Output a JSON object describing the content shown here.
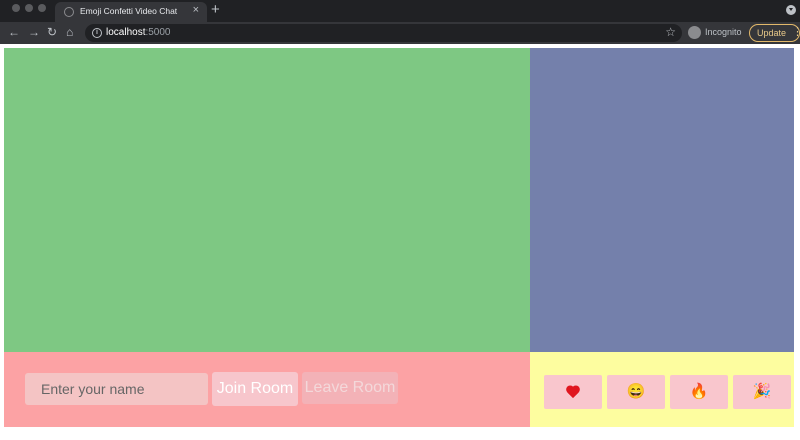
{
  "browser": {
    "tab_title": "Emoji Confetti Video Chat",
    "tab_close": "×",
    "new_tab": "+",
    "url_host": "localhost",
    "url_port": ":5000",
    "incognito_label": "Incognito",
    "update_label": "Update",
    "icons": [
      "back-icon",
      "forward-icon",
      "reload-icon",
      "home-icon",
      "info-icon",
      "star-icon",
      "incognito-icon",
      "menu-dots-icon"
    ]
  },
  "video": {
    "main_color": "#7ec883",
    "side_color": "#7480ab"
  },
  "controls": {
    "background": "#fca2a4",
    "name_placeholder": "Enter your name",
    "join_label": "Join Room",
    "leave_label": "Leave Room"
  },
  "reactions": {
    "background": "#fdfd9f",
    "items": [
      {
        "name": "heart",
        "glyph": "❤️"
      },
      {
        "name": "grinning-face",
        "glyph": "😄"
      },
      {
        "name": "fire",
        "glyph": "🔥"
      },
      {
        "name": "party-popper",
        "glyph": "🎉"
      }
    ]
  }
}
